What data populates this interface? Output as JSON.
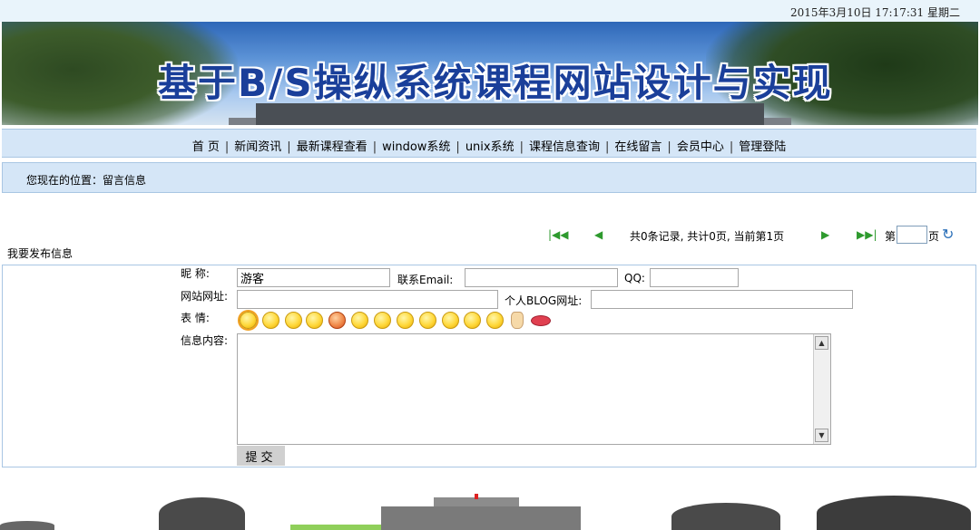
{
  "datetime": "2015年3月10日 17:17:31  星期二",
  "banner": {
    "title": "基于B/S操纵系统课程网站设计与实现"
  },
  "nav": {
    "items": [
      {
        "label": "首 页"
      },
      {
        "label": "新闻资讯"
      },
      {
        "label": "最新课程查看"
      },
      {
        "label": "window系统"
      },
      {
        "label": "unix系统"
      },
      {
        "label": "课程信息查询"
      },
      {
        "label": "在线留言"
      },
      {
        "label": "会员中心"
      },
      {
        "label": "管理登陆"
      }
    ],
    "separator": "|"
  },
  "location": {
    "text": "您现在的位置：留言信息"
  },
  "pager": {
    "first_icon": "first-page-icon",
    "prev_icon": "prev-page-icon",
    "summary": "共0条记录, 共计0页, 当前第1页",
    "next_icon": "next-page-icon",
    "last_icon": "last-page-icon",
    "goto_prefix": "第",
    "goto_suffix": "页",
    "goto_value": "",
    "refresh_icon": "go-refresh-icon"
  },
  "publish_label": "我要发布信息",
  "form": {
    "nickname_label": "昵    称:",
    "nickname_value": "游客",
    "email_label": "联系Email:",
    "email_value": "",
    "qq_label": "QQ:",
    "qq_value": "",
    "website_label": "网站网址:",
    "website_value": "",
    "blog_label": "个人BLOG网址:",
    "blog_value": "",
    "emotion_label": "表    情:",
    "emotions": [
      "smile-icon",
      "sad-icon",
      "grin-icon",
      "cry-icon",
      "angry-icon",
      "confused-icon",
      "tongue-icon",
      "shy-icon",
      "wink-icon",
      "smirk-icon",
      "sleepy-icon",
      "laugh-icon",
      "victory-icon",
      "kiss-icon"
    ],
    "content_label": "信息内容:",
    "content_value": "",
    "submit_label": "提交"
  },
  "colors": {
    "nav_bg": "#d5e6f7",
    "border": "#a9c6e3",
    "top_bg": "#e9f4fb",
    "title": "#1a3f9a"
  }
}
